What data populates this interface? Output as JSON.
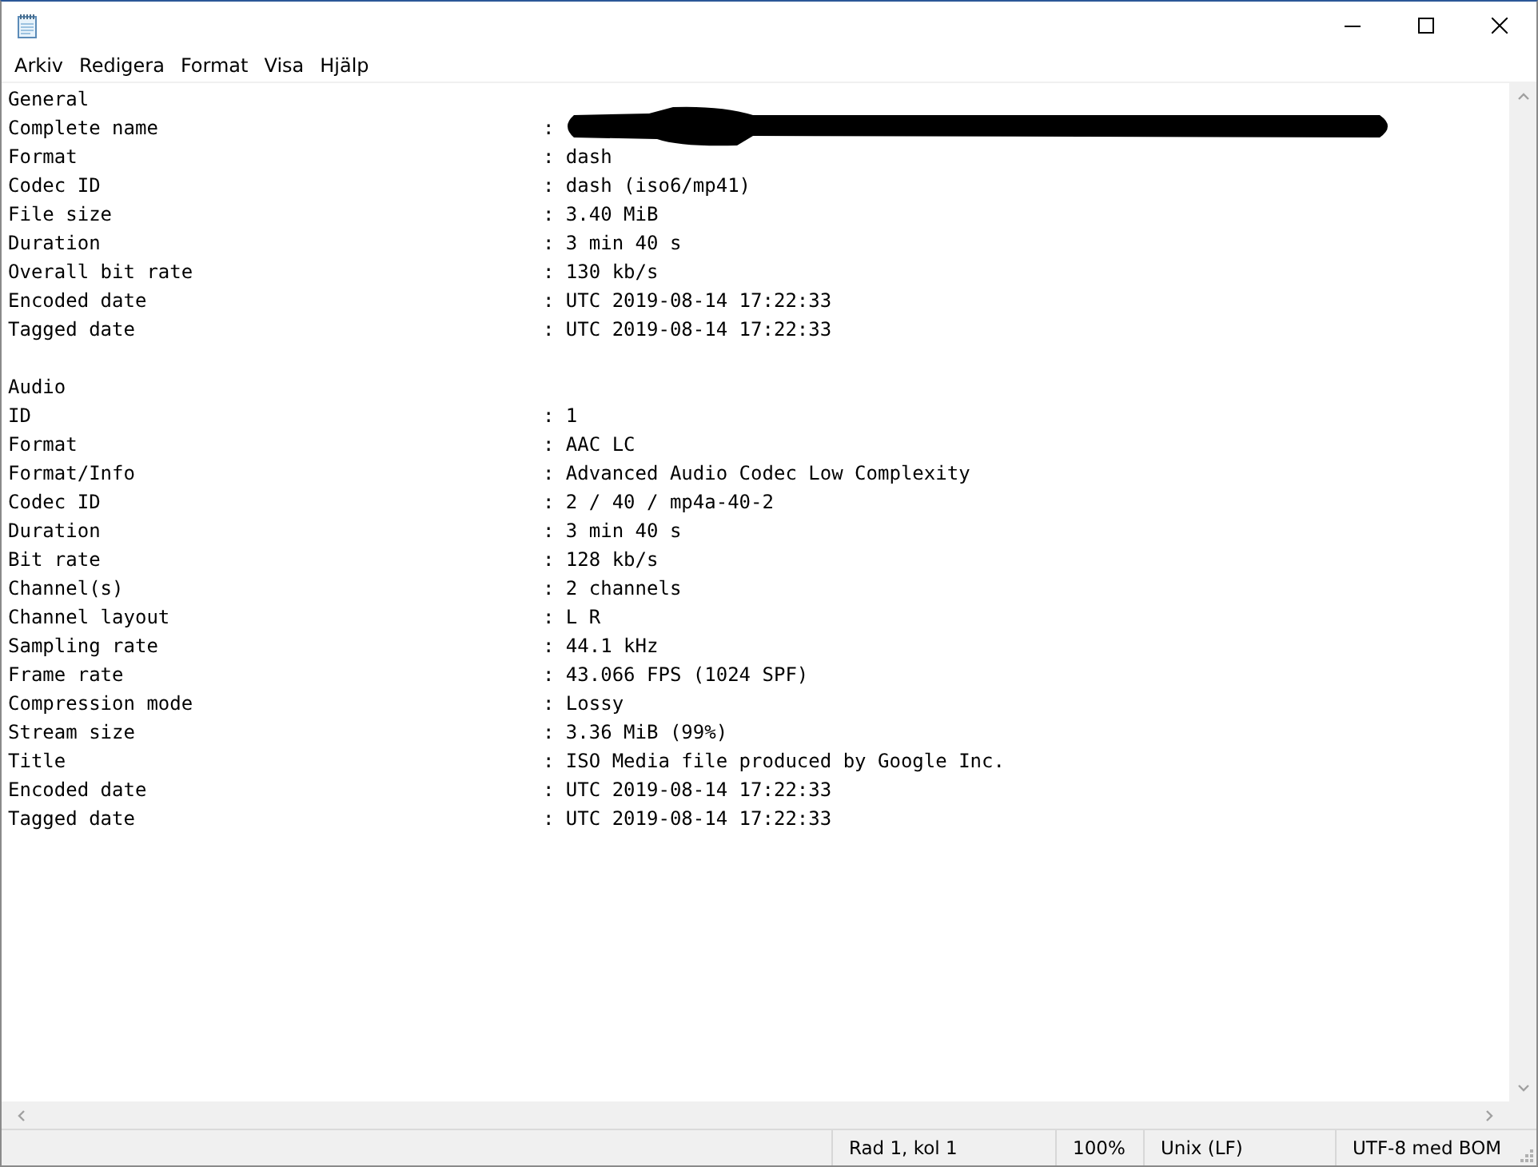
{
  "menu": [
    "Arkiv",
    "Redigera",
    "Format",
    "Visa",
    "Hjälp"
  ],
  "sections": [
    {
      "heading": "General",
      "lines": [
        {
          "label": "Complete name",
          "value": ":",
          "redacted": true
        },
        {
          "label": "Format",
          "value": ": dash",
          "redacted": false
        },
        {
          "label": "Codec ID",
          "value": ": dash (iso6/mp41)",
          "redacted": false
        },
        {
          "label": "File size",
          "value": ": 3.40 MiB",
          "redacted": false
        },
        {
          "label": "Duration",
          "value": ": 3 min 40 s",
          "redacted": false
        },
        {
          "label": "Overall bit rate",
          "value": ": 130 kb/s",
          "redacted": false
        },
        {
          "label": "Encoded date",
          "value": ": UTC 2019-08-14 17:22:33",
          "redacted": false
        },
        {
          "label": "Tagged date",
          "value": ": UTC 2019-08-14 17:22:33",
          "redacted": false
        }
      ]
    },
    {
      "heading": "Audio",
      "lines": [
        {
          "label": "ID",
          "value": ": 1",
          "redacted": false
        },
        {
          "label": "Format",
          "value": ": AAC LC",
          "redacted": false
        },
        {
          "label": "Format/Info",
          "value": ": Advanced Audio Codec Low Complexity",
          "redacted": false
        },
        {
          "label": "Codec ID",
          "value": ": 2 / 40 / mp4a-40-2",
          "redacted": false
        },
        {
          "label": "Duration",
          "value": ": 3 min 40 s",
          "redacted": false
        },
        {
          "label": "Bit rate",
          "value": ": 128 kb/s",
          "redacted": false
        },
        {
          "label": "Channel(s)",
          "value": ": 2 channels",
          "redacted": false
        },
        {
          "label": "Channel layout",
          "value": ": L R",
          "redacted": false
        },
        {
          "label": "Sampling rate",
          "value": ": 44.1 kHz",
          "redacted": false
        },
        {
          "label": "Frame rate",
          "value": ": 43.066 FPS (1024 SPF)",
          "redacted": false
        },
        {
          "label": "Compression mode",
          "value": ": Lossy",
          "redacted": false
        },
        {
          "label": "Stream size",
          "value": ": 3.36 MiB (99%)",
          "redacted": false
        },
        {
          "label": "Title",
          "value": ": ISO Media file produced by Google Inc.",
          "redacted": false
        },
        {
          "label": "Encoded date",
          "value": ": UTC 2019-08-14 17:22:33",
          "redacted": false
        },
        {
          "label": "Tagged date",
          "value": ": UTC 2019-08-14 17:22:33",
          "redacted": false
        }
      ]
    }
  ],
  "status_bar": {
    "position": "Rad 1, kol 1",
    "zoom": "100%",
    "line_ending": "Unix (LF)",
    "encoding": "UTF-8 med BOM"
  }
}
